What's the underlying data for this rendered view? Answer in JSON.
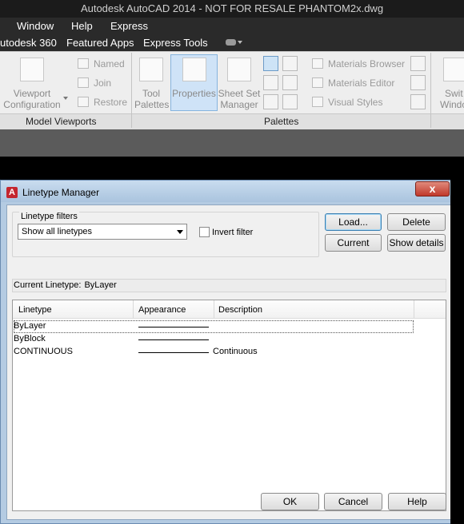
{
  "app": {
    "title": "Autodesk AutoCAD 2014 - NOT FOR RESALE    PHANTOM2x.dwg",
    "menu": [
      "Window",
      "Help",
      "Express"
    ],
    "tabs": [
      "utodesk 360",
      "Featured Apps",
      "Express Tools"
    ]
  },
  "ribbon": {
    "model_viewports": {
      "panel_label": "Model Viewports",
      "viewport_configuration": [
        "Viewport",
        "Configuration"
      ],
      "named": "Named",
      "join": "Join",
      "restore": "Restore"
    },
    "palettes": {
      "panel_label": "Palettes",
      "tool_palettes": [
        "Tool",
        "Palettes"
      ],
      "properties": "Properties",
      "sheet_set_manager": [
        "Sheet Set",
        "Manager"
      ],
      "materials_browser": "Materials Browser",
      "materials_editor": "Materials Editor",
      "visual_styles": "Visual Styles"
    },
    "switch_windows": [
      "Swit",
      "Windo"
    ]
  },
  "dialog": {
    "title": "Linetype Manager",
    "close_glyph": "x",
    "filters": {
      "group_label": "Linetype filters",
      "selected": "Show all linetypes",
      "invert_label": "Invert filter",
      "invert_checked": false
    },
    "buttons": {
      "load": "Load...",
      "delete": "Delete",
      "current": "Current",
      "show_details": "Show details",
      "ok": "OK",
      "cancel": "Cancel",
      "help": "Help"
    },
    "current_linetype_label": "Current Linetype:",
    "current_linetype_value": "ByLayer",
    "columns": [
      "Linetype",
      "Appearance",
      "Description"
    ],
    "rows": [
      {
        "linetype": "ByLayer",
        "description": ""
      },
      {
        "linetype": "ByBlock",
        "description": ""
      },
      {
        "linetype": "CONTINUOUS",
        "description": "Continuous"
      }
    ]
  }
}
